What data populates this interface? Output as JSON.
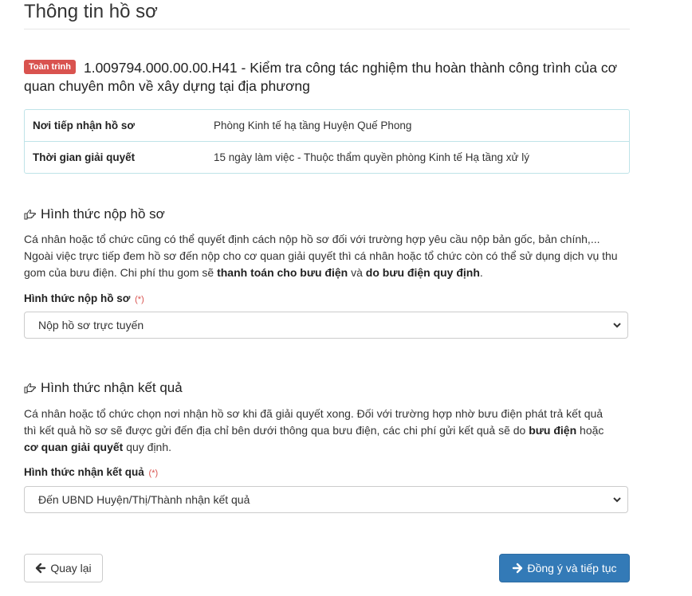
{
  "page": {
    "title": "Thông tin hồ sơ"
  },
  "procedure": {
    "badge": "Toàn trình",
    "heading": "1.009794.000.00.00.H41 - Kiểm tra công tác nghiệm thu hoàn thành công trình của cơ quan chuyên môn về xây dựng tại địa phương"
  },
  "info": {
    "rows": [
      {
        "label": "Nơi tiếp nhận hồ sơ",
        "value": "Phòng Kinh tế hạ tầng Huyện Quế Phong"
      },
      {
        "label": "Thời gian giải quyết",
        "value": "15 ngày làm việc - Thuộc thẩm quyền phòng Kinh tế Hạ tầng xử lý"
      }
    ]
  },
  "submit_section": {
    "heading": "Hình thức nộp hồ sơ",
    "desc_1": "Cá nhân hoặc tổ chức cũng có thể quyết định cách nộp hồ sơ đối với trường hợp yêu cầu nộp bản gốc, bản chính,... Ngoài việc trực tiếp đem hồ sơ đến nộp cho cơ quan giải quyết thì cá nhân hoặc tổ chức còn có thể sử dụng dịch vụ thu gom của bưu điện. Chi phí thu gom sẽ ",
    "desc_bold_1": "thanh toán cho bưu điện",
    "desc_2": " và ",
    "desc_bold_2": "do bưu điện quy định",
    "desc_3": ".",
    "field_label": "Hình thức nộp hồ sơ",
    "required_mark": "(*)",
    "selected": "Nộp hồ sơ trực tuyến"
  },
  "receive_section": {
    "heading": "Hình thức nhận kết quả",
    "desc_1": "Cá nhân hoặc tổ chức chọn nơi nhận hồ sơ khi đã giải quyết xong. Đối với trường hợp nhờ bưu điện phát trả kết quả thì kết quả hồ sơ sẽ được gửi đến địa chỉ bên dưới thông qua bưu điện, các chi phí gửi kết quả sẽ do ",
    "desc_bold_1": "bưu điện",
    "desc_2": " hoặc ",
    "desc_bold_2": "cơ quan giải quyết",
    "desc_3": " quy định.",
    "field_label": "Hình thức nhận kết quả",
    "required_mark": "(*)",
    "selected": "Đến UBND Huyện/Thị/Thành nhận kết quả"
  },
  "actions": {
    "back_label": "Quay lại",
    "next_label": "Đồng ý và tiếp tục"
  },
  "icons": {
    "hand": "hand-pointing-right-icon",
    "back": "arrow-left-icon",
    "next": "arrow-right-icon",
    "chevron": "chevron-down-icon"
  },
  "colors": {
    "badge": "#d9534f",
    "primary": "#337ab7",
    "required": "#d9534f",
    "table_border": "#bfe3e8"
  }
}
